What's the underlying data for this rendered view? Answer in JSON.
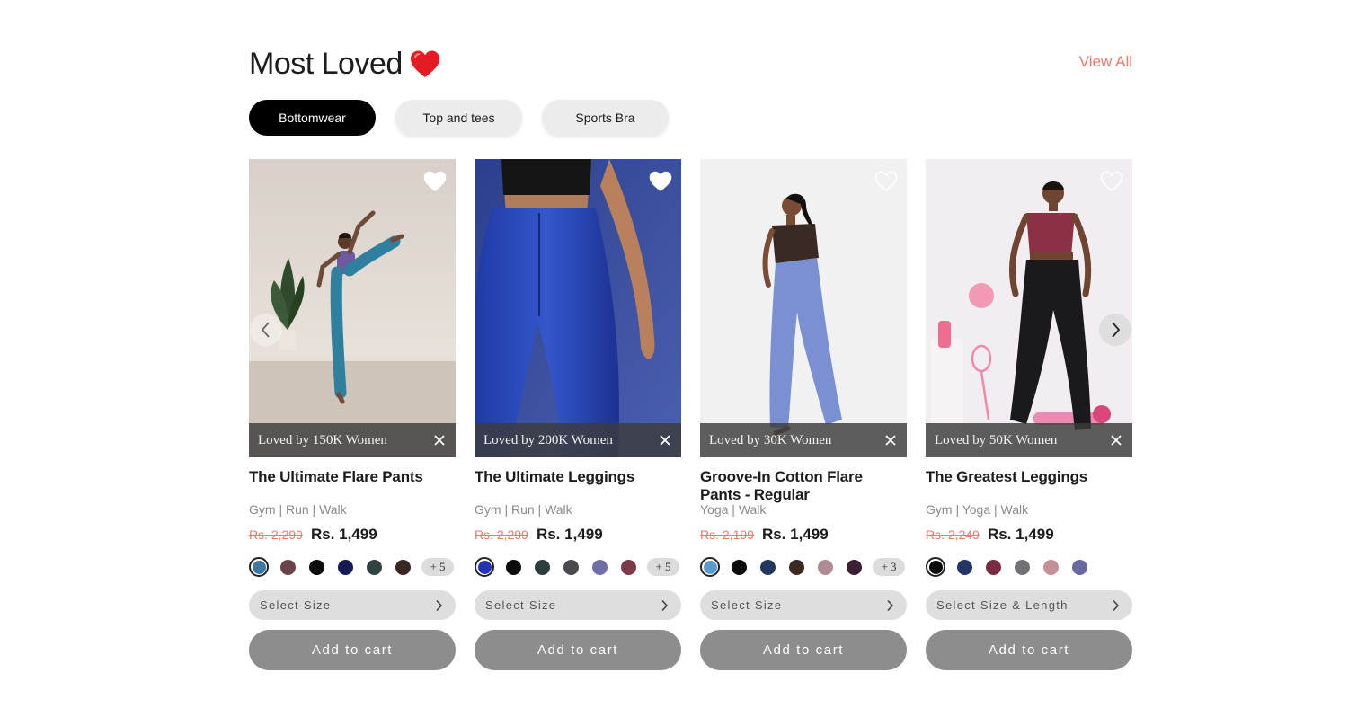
{
  "section": {
    "title": "Most Loved",
    "view_all": "View All"
  },
  "tabs": [
    {
      "label": "Bottomwear",
      "active": true
    },
    {
      "label": "Top and tees",
      "active": false
    },
    {
      "label": "Sports Bra",
      "active": false
    }
  ],
  "products": [
    {
      "name": "The Ultimate Flare Pants",
      "tags": "Gym | Run | Walk",
      "old_price": "Rs. 2,299",
      "price": "Rs. 1,499",
      "loved_by": "Loved by 150K Women",
      "swatches": [
        "#3f78a3",
        "#6b4249",
        "#0b0b0b",
        "#141a55",
        "#2f4442",
        "#3a2623"
      ],
      "more_colors": "+ 5",
      "select_label": "Select Size",
      "cart_label": "Add to cart"
    },
    {
      "name": "The Ultimate Leggings",
      "tags": "Gym | Run | Walk",
      "old_price": "Rs. 2,299",
      "price": "Rs. 1,499",
      "loved_by": "Loved by 200K Women",
      "swatches": [
        "#2433b6",
        "#0b0b0b",
        "#2b3e3d",
        "#4a4a4e",
        "#6f6fa8",
        "#7a3a47"
      ],
      "more_colors": "+ 5",
      "select_label": "Select Size",
      "cart_label": "Add to cart"
    },
    {
      "name": "Groove-In Cotton Flare Pants - Regular",
      "tags": "Yoga | Walk",
      "old_price": "Rs. 2,199",
      "price": "Rs. 1,499",
      "loved_by": "Loved by 30K Women",
      "swatches": [
        "#5c9bd0",
        "#0b0b0b",
        "#223760",
        "#3b2a22",
        "#b18a95",
        "#3b1f33"
      ],
      "more_colors": "+ 3",
      "select_label": "Select Size",
      "cart_label": "Add to cart"
    },
    {
      "name": "The Greatest Leggings",
      "tags": "Gym | Yoga | Walk",
      "old_price": "Rs. 2,249",
      "price": "Rs. 1,499",
      "loved_by": "Loved by 50K Women",
      "swatches": [
        "#0b0b0b",
        "#223766",
        "#7a2d42",
        "#707075",
        "#c49097",
        "#6a6aa0"
      ],
      "more_colors": "",
      "select_label": "Select Size & Length",
      "cart_label": "Add to cart"
    }
  ],
  "colors": {
    "accent": "#f0786a",
    "tab_active_bg": "#000000",
    "button_gray": "#8d8d8d"
  },
  "icons": {
    "title_emoji": "red-heart-emoji",
    "wishlist": "heart-outline-icon",
    "close": "close-icon",
    "prev": "chevron-left-icon",
    "next": "chevron-right-icon"
  }
}
